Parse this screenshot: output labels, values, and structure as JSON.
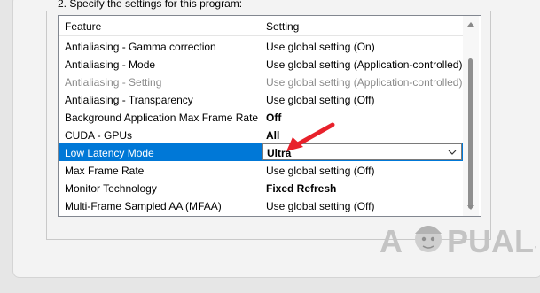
{
  "section_label": "2. Specify the settings for this program:",
  "columns": {
    "feature": "Feature",
    "setting": "Setting"
  },
  "rows": [
    {
      "feature": "Antialiasing - Gamma correction",
      "setting": "Use global setting (On)"
    },
    {
      "feature": "Antialiasing - Mode",
      "setting": "Use global setting (Application-controlled)"
    },
    {
      "feature": "Antialiasing - Setting",
      "setting": "Use global setting (Application-controlled)",
      "disabled": true
    },
    {
      "feature": "Antialiasing - Transparency",
      "setting": "Use global setting (Off)"
    },
    {
      "feature": "Background Application Max Frame Rate",
      "setting": "Off",
      "bold": true
    },
    {
      "feature": "CUDA - GPUs",
      "setting": "All",
      "bold": true
    },
    {
      "feature": "Low Latency Mode",
      "setting": "Ultra",
      "bold": true,
      "selected": true
    },
    {
      "feature": "Max Frame Rate",
      "setting": "Use global setting (Off)"
    },
    {
      "feature": "Monitor Technology",
      "setting": "Fixed Refresh",
      "bold": true
    },
    {
      "feature": "Multi-Frame Sampled AA (MFAA)",
      "setting": "Use global setting (Off)"
    }
  ],
  "watermark": {
    "left": "A",
    "right": "PUALS"
  },
  "icons": {
    "dropdown": "chevron-down-icon",
    "scroll_up": "scroll-up-arrow-icon",
    "scroll_down": "scroll-down-arrow-icon",
    "annotation": "red-arrow-icon"
  },
  "colors": {
    "selection": "#0078d7",
    "annotation_arrow": "#e8212b"
  }
}
